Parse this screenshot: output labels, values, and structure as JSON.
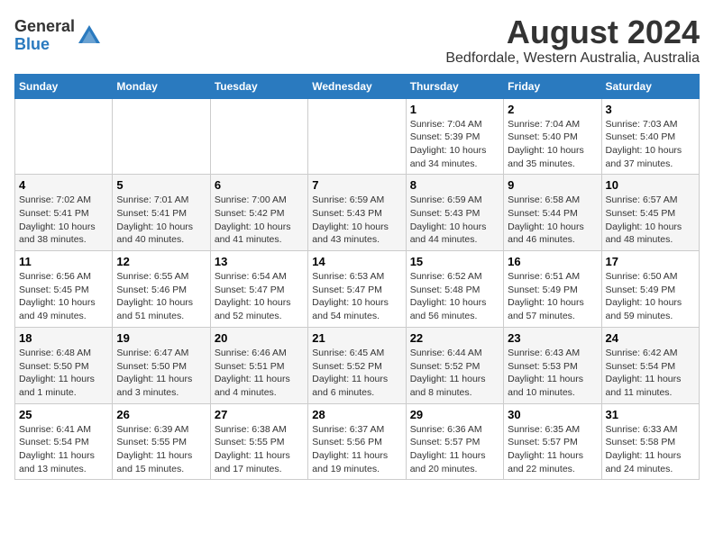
{
  "header": {
    "logo_general": "General",
    "logo_blue": "Blue",
    "title": "August 2024",
    "subtitle": "Bedfordale, Western Australia, Australia"
  },
  "days_of_week": [
    "Sunday",
    "Monday",
    "Tuesday",
    "Wednesday",
    "Thursday",
    "Friday",
    "Saturday"
  ],
  "weeks": [
    [
      {
        "day": "",
        "info": ""
      },
      {
        "day": "",
        "info": ""
      },
      {
        "day": "",
        "info": ""
      },
      {
        "day": "",
        "info": ""
      },
      {
        "day": "1",
        "info": "Sunrise: 7:04 AM\nSunset: 5:39 PM\nDaylight: 10 hours\nand 34 minutes."
      },
      {
        "day": "2",
        "info": "Sunrise: 7:04 AM\nSunset: 5:40 PM\nDaylight: 10 hours\nand 35 minutes."
      },
      {
        "day": "3",
        "info": "Sunrise: 7:03 AM\nSunset: 5:40 PM\nDaylight: 10 hours\nand 37 minutes."
      }
    ],
    [
      {
        "day": "4",
        "info": "Sunrise: 7:02 AM\nSunset: 5:41 PM\nDaylight: 10 hours\nand 38 minutes."
      },
      {
        "day": "5",
        "info": "Sunrise: 7:01 AM\nSunset: 5:41 PM\nDaylight: 10 hours\nand 40 minutes."
      },
      {
        "day": "6",
        "info": "Sunrise: 7:00 AM\nSunset: 5:42 PM\nDaylight: 10 hours\nand 41 minutes."
      },
      {
        "day": "7",
        "info": "Sunrise: 6:59 AM\nSunset: 5:43 PM\nDaylight: 10 hours\nand 43 minutes."
      },
      {
        "day": "8",
        "info": "Sunrise: 6:59 AM\nSunset: 5:43 PM\nDaylight: 10 hours\nand 44 minutes."
      },
      {
        "day": "9",
        "info": "Sunrise: 6:58 AM\nSunset: 5:44 PM\nDaylight: 10 hours\nand 46 minutes."
      },
      {
        "day": "10",
        "info": "Sunrise: 6:57 AM\nSunset: 5:45 PM\nDaylight: 10 hours\nand 48 minutes."
      }
    ],
    [
      {
        "day": "11",
        "info": "Sunrise: 6:56 AM\nSunset: 5:45 PM\nDaylight: 10 hours\nand 49 minutes."
      },
      {
        "day": "12",
        "info": "Sunrise: 6:55 AM\nSunset: 5:46 PM\nDaylight: 10 hours\nand 51 minutes."
      },
      {
        "day": "13",
        "info": "Sunrise: 6:54 AM\nSunset: 5:47 PM\nDaylight: 10 hours\nand 52 minutes."
      },
      {
        "day": "14",
        "info": "Sunrise: 6:53 AM\nSunset: 5:47 PM\nDaylight: 10 hours\nand 54 minutes."
      },
      {
        "day": "15",
        "info": "Sunrise: 6:52 AM\nSunset: 5:48 PM\nDaylight: 10 hours\nand 56 minutes."
      },
      {
        "day": "16",
        "info": "Sunrise: 6:51 AM\nSunset: 5:49 PM\nDaylight: 10 hours\nand 57 minutes."
      },
      {
        "day": "17",
        "info": "Sunrise: 6:50 AM\nSunset: 5:49 PM\nDaylight: 10 hours\nand 59 minutes."
      }
    ],
    [
      {
        "day": "18",
        "info": "Sunrise: 6:48 AM\nSunset: 5:50 PM\nDaylight: 11 hours\nand 1 minute."
      },
      {
        "day": "19",
        "info": "Sunrise: 6:47 AM\nSunset: 5:50 PM\nDaylight: 11 hours\nand 3 minutes."
      },
      {
        "day": "20",
        "info": "Sunrise: 6:46 AM\nSunset: 5:51 PM\nDaylight: 11 hours\nand 4 minutes."
      },
      {
        "day": "21",
        "info": "Sunrise: 6:45 AM\nSunset: 5:52 PM\nDaylight: 11 hours\nand 6 minutes."
      },
      {
        "day": "22",
        "info": "Sunrise: 6:44 AM\nSunset: 5:52 PM\nDaylight: 11 hours\nand 8 minutes."
      },
      {
        "day": "23",
        "info": "Sunrise: 6:43 AM\nSunset: 5:53 PM\nDaylight: 11 hours\nand 10 minutes."
      },
      {
        "day": "24",
        "info": "Sunrise: 6:42 AM\nSunset: 5:54 PM\nDaylight: 11 hours\nand 11 minutes."
      }
    ],
    [
      {
        "day": "25",
        "info": "Sunrise: 6:41 AM\nSunset: 5:54 PM\nDaylight: 11 hours\nand 13 minutes."
      },
      {
        "day": "26",
        "info": "Sunrise: 6:39 AM\nSunset: 5:55 PM\nDaylight: 11 hours\nand 15 minutes."
      },
      {
        "day": "27",
        "info": "Sunrise: 6:38 AM\nSunset: 5:55 PM\nDaylight: 11 hours\nand 17 minutes."
      },
      {
        "day": "28",
        "info": "Sunrise: 6:37 AM\nSunset: 5:56 PM\nDaylight: 11 hours\nand 19 minutes."
      },
      {
        "day": "29",
        "info": "Sunrise: 6:36 AM\nSunset: 5:57 PM\nDaylight: 11 hours\nand 20 minutes."
      },
      {
        "day": "30",
        "info": "Sunrise: 6:35 AM\nSunset: 5:57 PM\nDaylight: 11 hours\nand 22 minutes."
      },
      {
        "day": "31",
        "info": "Sunrise: 6:33 AM\nSunset: 5:58 PM\nDaylight: 11 hours\nand 24 minutes."
      }
    ]
  ]
}
